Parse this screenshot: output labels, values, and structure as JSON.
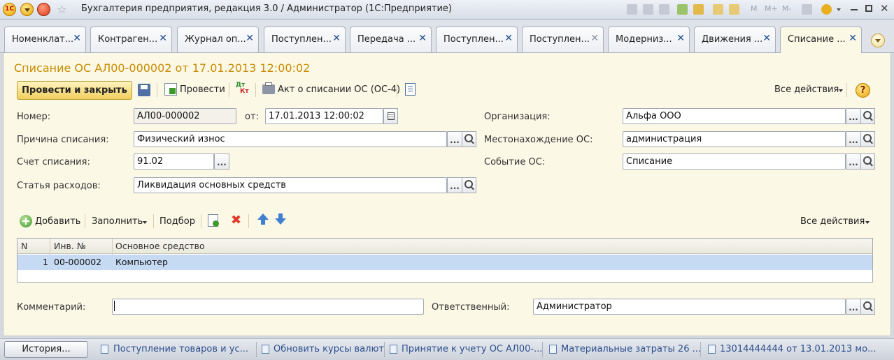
{
  "window": {
    "logo_text": "1С",
    "title": "Бухгалтерия предприятия, редакция 3.0 / Администратор  (1С:Предприятие)",
    "memory_buttons": [
      "M",
      "M+",
      "M-"
    ]
  },
  "tabs": [
    {
      "label": "Номенклат..."
    },
    {
      "label": "Контраген..."
    },
    {
      "label": "Журнал оп..."
    },
    {
      "label": "Поступлен..."
    },
    {
      "label": "Передача ..."
    },
    {
      "label": "Поступлен..."
    },
    {
      "label": "Поступлен..."
    },
    {
      "label": "Модерниз..."
    },
    {
      "label": "Движения ..."
    },
    {
      "label": "Списание ...",
      "active": true
    }
  ],
  "tab_close_glyph": "✕",
  "form": {
    "title": "Списание ОС АЛ00-000002 от 17.01.2013 12:00:02",
    "toolbar": {
      "post_and_close": "Провести и закрыть",
      "post": "Провести",
      "dtkt_top": "Дт",
      "dtkt_bottom": "Кт",
      "print_act": "Акт о списании ОС (ОС-4)",
      "all_actions": "Все действия",
      "help": "?"
    },
    "fields": {
      "number_label": "Номер:",
      "number_value": "АЛ00-000002",
      "date_label": "от:",
      "date_value": "17.01.2013 12:00:02",
      "reason_label": "Причина списания:",
      "reason_value": "Физический износ",
      "account_label": "Счет списания:",
      "account_value": "91.02",
      "expense_label": "Статья расходов:",
      "expense_value": "Ликвидация основных средств",
      "org_label": "Организация:",
      "org_value": "Альфа ООО",
      "location_label": "Местонахождение ОС:",
      "location_value": "администрация",
      "event_label": "Событие ОС:",
      "event_value": "Списание",
      "select_glyph": "..."
    },
    "table_toolbar": {
      "add": "Добавить",
      "fill": "Заполнить",
      "pick": "Подбор",
      "all_actions": "Все действия"
    },
    "table": {
      "columns": [
        "N",
        "Инв. №",
        "Основное средство"
      ],
      "rows": [
        {
          "n": "1",
          "inv": "00-000002",
          "asset": "Компьютер"
        }
      ]
    },
    "footer": {
      "comment_label": "Комментарий:",
      "comment_value": "",
      "responsible_label": "Ответственный:",
      "responsible_value": "Администратор"
    }
  },
  "bottom": {
    "history": "История...",
    "items": [
      "Поступление товаров и ус...",
      "Обновить курсы валют",
      "Принятие к учету ОС АЛ00-...",
      "Материальные затраты 26 ...",
      "13014444444 от 13.01.2013 мо..."
    ]
  },
  "colors": {
    "accent_title": "#c98c00",
    "form_bg": "#fbf8e6",
    "selected_row": "#c6dbf3",
    "link": "#2c4f8e"
  }
}
